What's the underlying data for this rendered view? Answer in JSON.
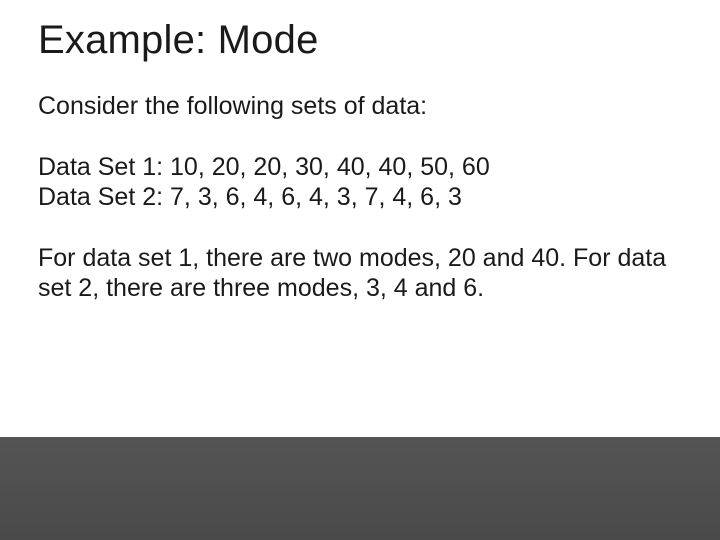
{
  "title": "Example: Mode",
  "intro": "Consider the following sets of data:",
  "set1_line": "Data Set 1: 10, 20, 20, 30, 40, 40, 50, 60",
  "set2_line": "Data Set 2: 7, 3, 6, 4, 6, 4, 3, 7, 4, 6, 3",
  "conclusion": "For data set 1, there are two modes, 20 and 40. For data set 2, there are three modes, 3, 4 and 6."
}
